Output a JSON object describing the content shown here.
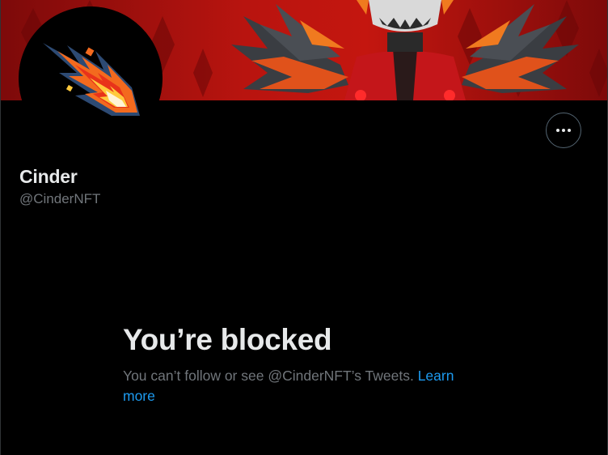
{
  "profile": {
    "display_name": "Cinder",
    "handle": "@CinderNFT"
  },
  "header": {
    "more_icon": "more-horizontal-icon"
  },
  "blocked": {
    "title": "You’re blocked",
    "message": "You can’t follow or see @CinderNFT’s Tweets.",
    "learn_more": "Learn more"
  },
  "colors": {
    "background": "#000000",
    "primary_text": "#e7e9ea",
    "secondary_text": "#71767b",
    "link": "#1d9bf0",
    "banner_red": "#b3120f"
  }
}
